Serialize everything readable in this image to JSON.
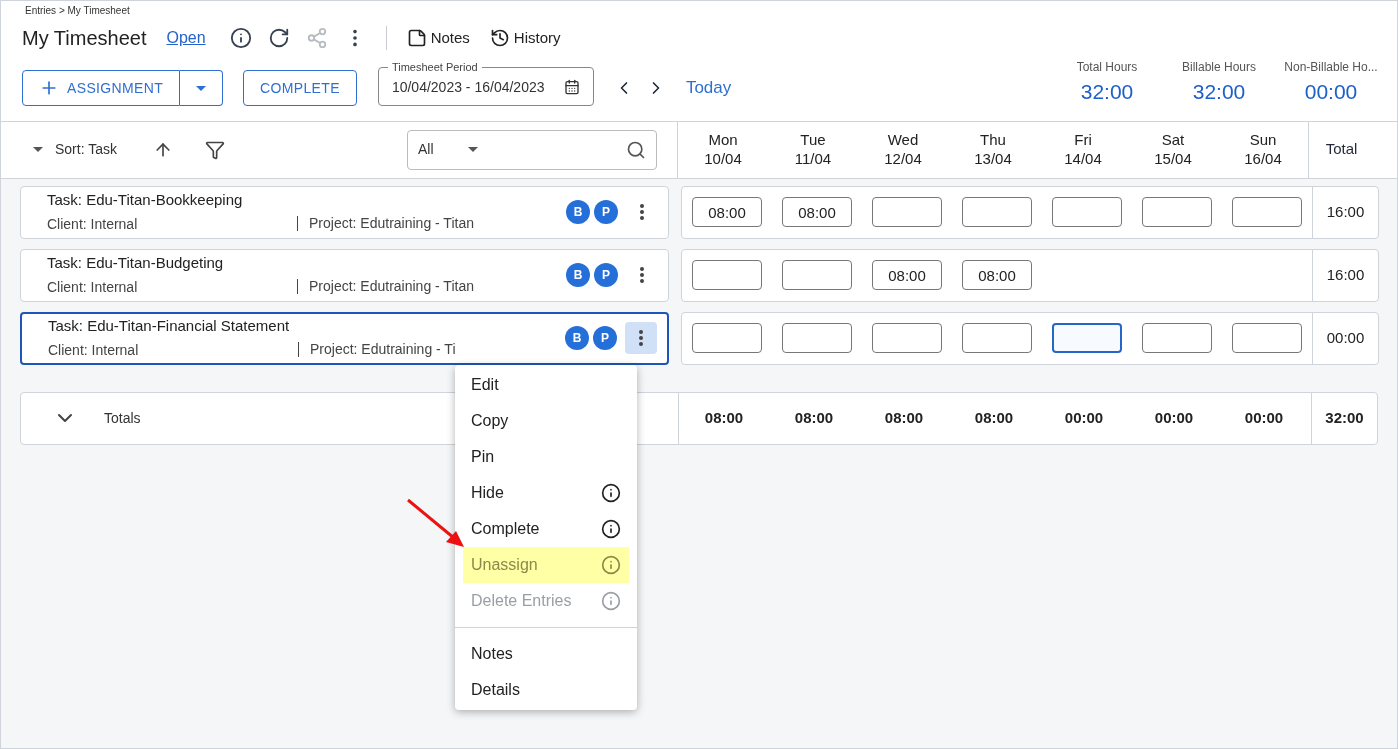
{
  "breadcrumb": "Entries > My Timesheet",
  "title": "My Timesheet",
  "status_link": "Open",
  "toolbar": [
    {
      "kind": "info",
      "disabled": false
    },
    {
      "kind": "refresh",
      "disabled": false
    },
    {
      "kind": "share",
      "disabled": true
    },
    {
      "kind": "more",
      "disabled": false
    }
  ],
  "toolbar_buttons": [
    {
      "kind": "notes",
      "label": "Notes"
    },
    {
      "kind": "history",
      "label": "History"
    }
  ],
  "assignment_button": "ASSIGNMENT",
  "complete_button": "COMPLETE",
  "period": {
    "label": "Timesheet Period",
    "value": "10/04/2023 - 16/04/2023"
  },
  "today_link": "Today",
  "summary": [
    {
      "label": "Total Hours",
      "value": "32:00"
    },
    {
      "label": "Billable Hours",
      "value": "32:00"
    },
    {
      "label": "Non-Billable Ho...",
      "value": "00:00"
    }
  ],
  "sort": {
    "label": "Sort: Task"
  },
  "filter": {
    "value": "All"
  },
  "days": [
    {
      "name": "Mon",
      "date": "10/04"
    },
    {
      "name": "Tue",
      "date": "11/04"
    },
    {
      "name": "Wed",
      "date": "12/04"
    },
    {
      "name": "Thu",
      "date": "13/04"
    },
    {
      "name": "Fri",
      "date": "14/04"
    },
    {
      "name": "Sat",
      "date": "15/04"
    },
    {
      "name": "Sun",
      "date": "16/04"
    }
  ],
  "total_header": "Total",
  "rows": [
    {
      "task": "Task: Edu-Titan-Bookkeeping",
      "client": "Client: Internal",
      "project": "Project: Edutraining - Titan",
      "badges": [
        "B",
        "P"
      ],
      "selected": false,
      "total": "16:00",
      "cells": [
        {
          "kind": "field",
          "value": "08:00",
          "focused": false
        },
        {
          "kind": "field",
          "value": "08:00",
          "focused": false
        },
        {
          "kind": "field",
          "focused": false
        },
        {
          "kind": "field",
          "focused": false
        },
        {
          "kind": "field",
          "focused": false
        },
        {
          "kind": "field",
          "focused": false
        },
        {
          "kind": "field",
          "focused": false
        }
      ]
    },
    {
      "task": "Task: Edu-Titan-Budgeting",
      "client": "Client: Internal",
      "project": "Project: Edutraining - Titan",
      "badges": [
        "B",
        "P"
      ],
      "selected": false,
      "total": "16:00",
      "cells": [
        {
          "kind": "field",
          "focused": false
        },
        {
          "kind": "field",
          "focused": false
        },
        {
          "kind": "field",
          "value": "08:00",
          "focused": false
        },
        {
          "kind": "field",
          "value": "08:00",
          "focused": false
        },
        {
          "kind": "blank"
        },
        {
          "kind": "blank"
        },
        {
          "kind": "blank"
        }
      ]
    },
    {
      "task": "Task: Edu-Titan-Financial Statement",
      "client": "Client: Internal",
      "project": "Project: Edutraining - Ti",
      "badges": [
        "B",
        "P"
      ],
      "selected": true,
      "total": "00:00",
      "cells": [
        {
          "kind": "field",
          "focused": false
        },
        {
          "kind": "field",
          "focused": false
        },
        {
          "kind": "field",
          "focused": false
        },
        {
          "kind": "field",
          "focused": false
        },
        {
          "kind": "field",
          "focused": true
        },
        {
          "kind": "field",
          "focused": false
        },
        {
          "kind": "field",
          "focused": false
        }
      ]
    }
  ],
  "totals": {
    "label": "Totals",
    "expanded": true,
    "values": [
      "08:00",
      "08:00",
      "08:00",
      "08:00",
      "00:00",
      "00:00",
      "00:00"
    ],
    "total": "32:00"
  },
  "context_menu": [
    {
      "label": "Edit",
      "disabled": false,
      "highlighted": false,
      "info": false,
      "divider_before": false
    },
    {
      "label": "Copy",
      "disabled": false,
      "highlighted": false,
      "info": false,
      "divider_before": false
    },
    {
      "label": "Pin",
      "disabled": false,
      "highlighted": false,
      "info": false,
      "divider_before": false
    },
    {
      "label": "Hide",
      "disabled": false,
      "highlighted": false,
      "info": true,
      "divider_before": false
    },
    {
      "label": "Complete",
      "disabled": false,
      "highlighted": false,
      "info": true,
      "divider_before": false
    },
    {
      "label": "Unassign",
      "disabled": true,
      "highlighted": true,
      "info": true,
      "divider_before": false
    },
    {
      "label": "Delete Entries",
      "disabled": true,
      "highlighted": false,
      "info": true,
      "divider_before": false
    },
    {
      "label": "Notes",
      "disabled": false,
      "highlighted": false,
      "info": false,
      "divider_before": true
    },
    {
      "label": "Details",
      "disabled": false,
      "highlighted": false,
      "info": false,
      "divider_before": false
    }
  ]
}
